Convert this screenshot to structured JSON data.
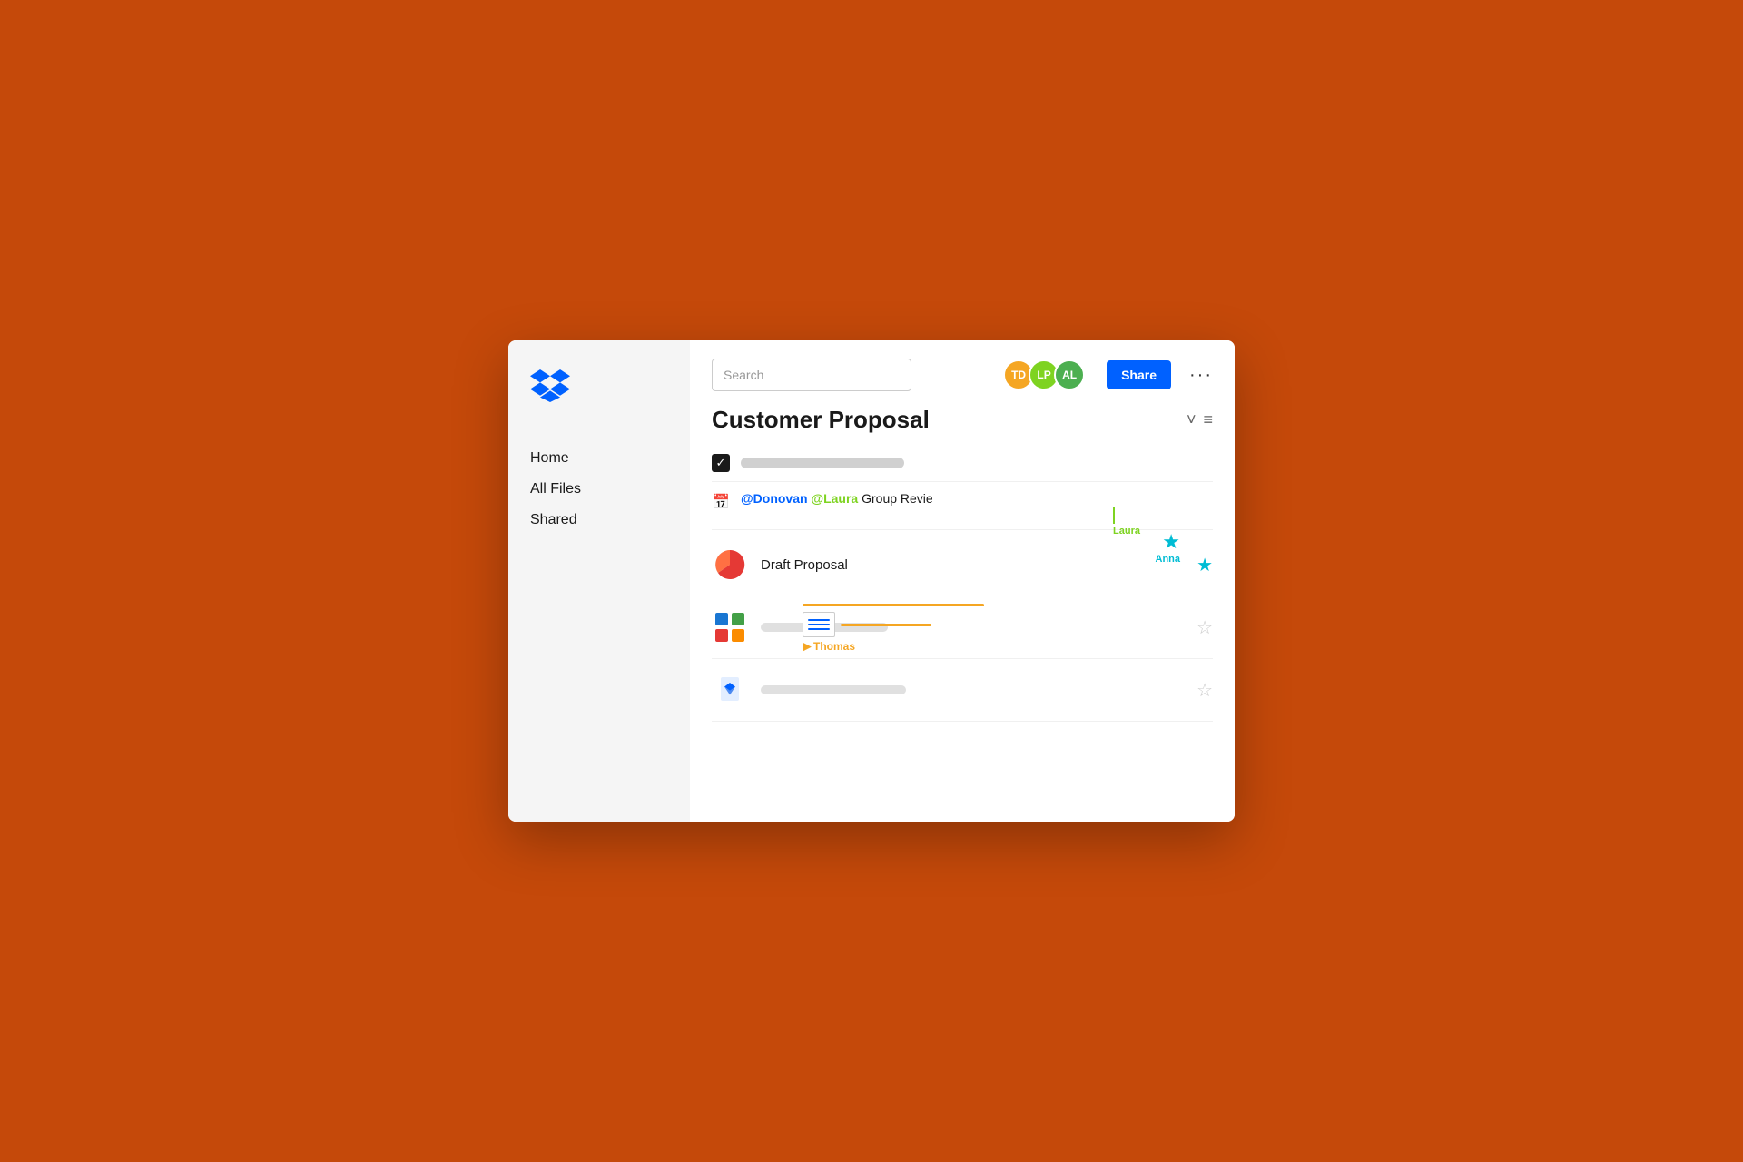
{
  "background": "#C5490A",
  "sidebar": {
    "nav_items": [
      {
        "label": "Home",
        "id": "home"
      },
      {
        "label": "All Files",
        "id": "all-files"
      },
      {
        "label": "Shared",
        "id": "shared"
      }
    ]
  },
  "header": {
    "search_placeholder": "Search",
    "avatars": [
      {
        "initials": "TD",
        "color": "#f5a623",
        "id": "td"
      },
      {
        "initials": "LP",
        "color": "#7ed321",
        "id": "lp"
      },
      {
        "initials": "AL",
        "color": "#4caf50",
        "id": "al"
      }
    ],
    "share_label": "Share",
    "more_label": "···"
  },
  "document": {
    "title": "Customer Proposal",
    "chevron": "˅",
    "menu": "≡"
  },
  "task": {
    "checked": true
  },
  "calendar_row": {
    "mention_donovan": "@Donovan",
    "mention_laura": "@Laura",
    "text": " Group Revie",
    "cursor_user": "Laura"
  },
  "files": [
    {
      "name": "Draft Proposal",
      "type": "pie",
      "starred": true,
      "star_user": "Anna"
    },
    {
      "name": "",
      "type": "grid",
      "starred": false,
      "cursor_user": "Thomas"
    },
    {
      "name": "",
      "type": "dropbox",
      "starred": false
    }
  ],
  "collaborators": {
    "anna": "Anna",
    "thomas": "Thomas",
    "laura": "Laura"
  }
}
